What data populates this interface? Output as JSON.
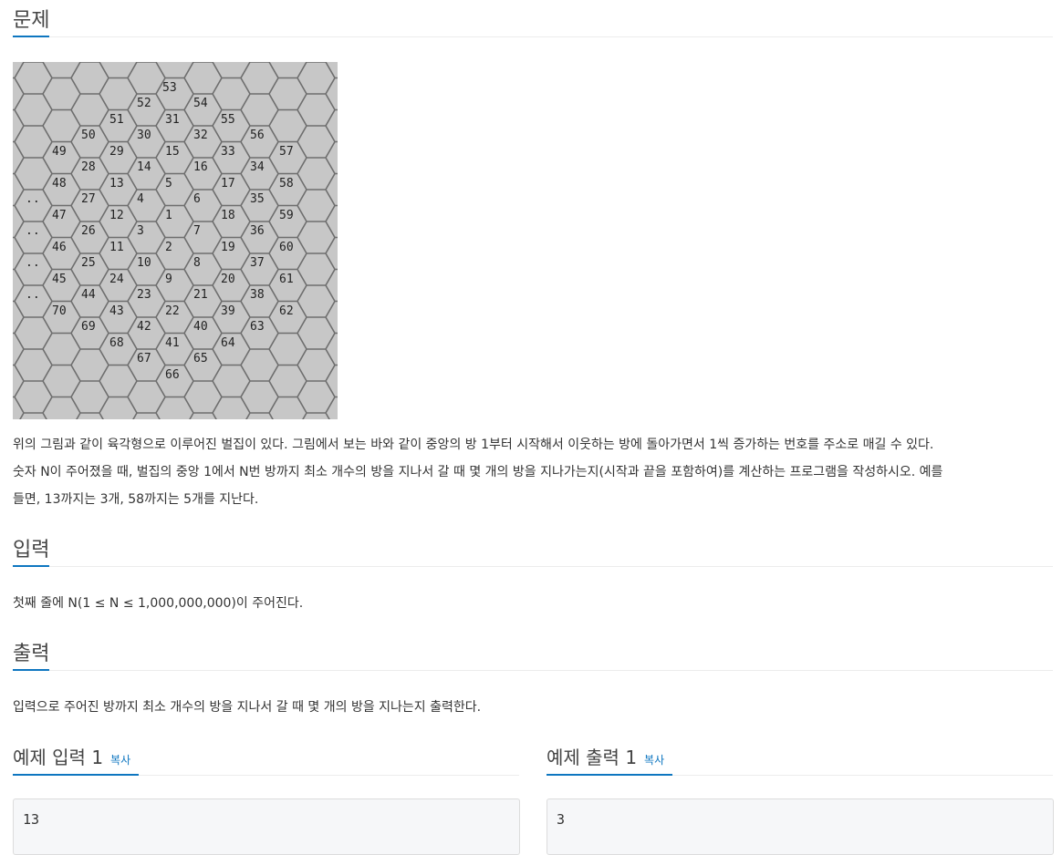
{
  "problem": {
    "heading": "문제",
    "lines": [
      "위의 그림과 같이 육각형으로 이루어진 벌집이 있다. 그림에서 보는 바와 같이 중앙의 방 1부터 시작해서 이웃하는 방에 돌아가면서 1씩 증가하는 번호를 주소로 매길 수 있다.",
      "숫자 N이 주어졌을 때, 벌집의 중앙 1에서 N번 방까지 최소 개수의 방을 지나서 갈 때 몇 개의 방을 지나가는지(시작과 끝을 포함하여)를 계산하는 프로그램을 작성하시오. 예를",
      "들면, 13까지는 3개, 58까지는 5개를 지난다."
    ]
  },
  "figure": {
    "labels": [
      "53",
      "52",
      "54",
      "51",
      "31",
      "55",
      "50",
      "30",
      "32",
      "56",
      "49",
      "29",
      "15",
      "33",
      "57",
      "28",
      "14",
      "16",
      "34",
      "48",
      "13",
      "5",
      "17",
      "58",
      "..",
      "27",
      "4",
      "6",
      "35",
      "47",
      "12",
      "1",
      "18",
      "59",
      "..",
      "26",
      "3",
      "7",
      "36",
      "46",
      "11",
      "2",
      "19",
      "60",
      "..",
      "25",
      "10",
      "8",
      "37",
      "45",
      "24",
      "9",
      "20",
      "61",
      "..",
      "44",
      "23",
      "21",
      "38",
      "70",
      "43",
      "22",
      "39",
      "62",
      "69",
      "42",
      "40",
      "63",
      "68",
      "41",
      "64",
      "67",
      "65",
      "66"
    ]
  },
  "input": {
    "heading": "입력",
    "text": "첫째 줄에 N(1 ≤ N ≤ 1,000,000,000)이 주어진다."
  },
  "output": {
    "heading": "출력",
    "text": "입력으로 주어진 방까지 최소 개수의 방을 지나서 갈 때 몇 개의 방을 지나는지 출력한다."
  },
  "samples": {
    "input_title": "예제 입력 1",
    "output_title": "예제 출력 1",
    "copy_label": "복사",
    "input_value": "13",
    "output_value": "3"
  }
}
